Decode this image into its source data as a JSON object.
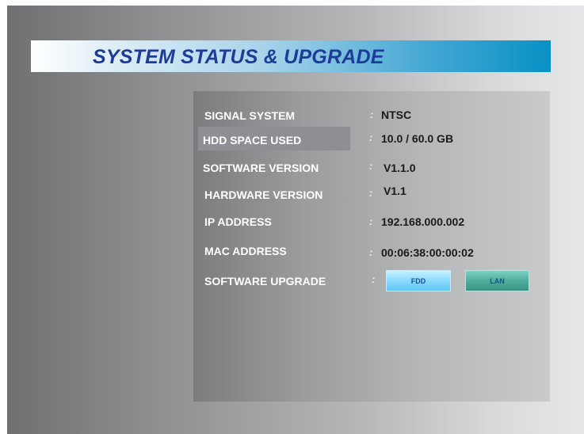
{
  "title": "SYSTEM STATUS & UPGRADE",
  "colon": ":",
  "rows": [
    {
      "label": "SIGNAL SYSTEM",
      "value": "NTSC"
    },
    {
      "label": "HDD SPACE USED",
      "value": "10.0 / 60.0 GB"
    },
    {
      "label": "SOFTWARE VERSION",
      "value": "V1.1.0"
    },
    {
      "label": "HARDWARE VERSION",
      "value": "V1.1"
    },
    {
      "label": "IP ADDRESS",
      "value": "192.168.000.002"
    },
    {
      "label": "MAC ADDRESS",
      "value": "00:06:38:00:00:02"
    }
  ],
  "upgrade": {
    "label": "SOFTWARE UPGRADE",
    "buttons": {
      "fdd": "FDD",
      "lan": "LAN"
    }
  },
  "colors": {
    "title_text": "#1e3c97",
    "title_bar_end": "#0891c5",
    "fdd_button": "#8fdcff",
    "lan_button": "#4fae9c"
  }
}
